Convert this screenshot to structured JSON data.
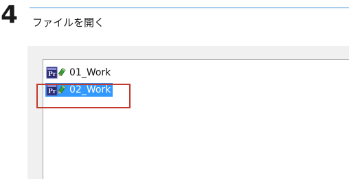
{
  "step": {
    "number": "4",
    "title": "ファイルを開く"
  },
  "file_list": {
    "items": [
      {
        "label": "01_Work",
        "icon": "premiere-project-icon",
        "selected": false
      },
      {
        "label": "02_Work",
        "icon": "premiere-project-icon",
        "selected": true
      }
    ]
  },
  "colors": {
    "accent_rule": "#3a8fd6",
    "selection": "#3399ff",
    "highlight_box": "#c0392b",
    "dialog_background": "#f0f0f0"
  }
}
